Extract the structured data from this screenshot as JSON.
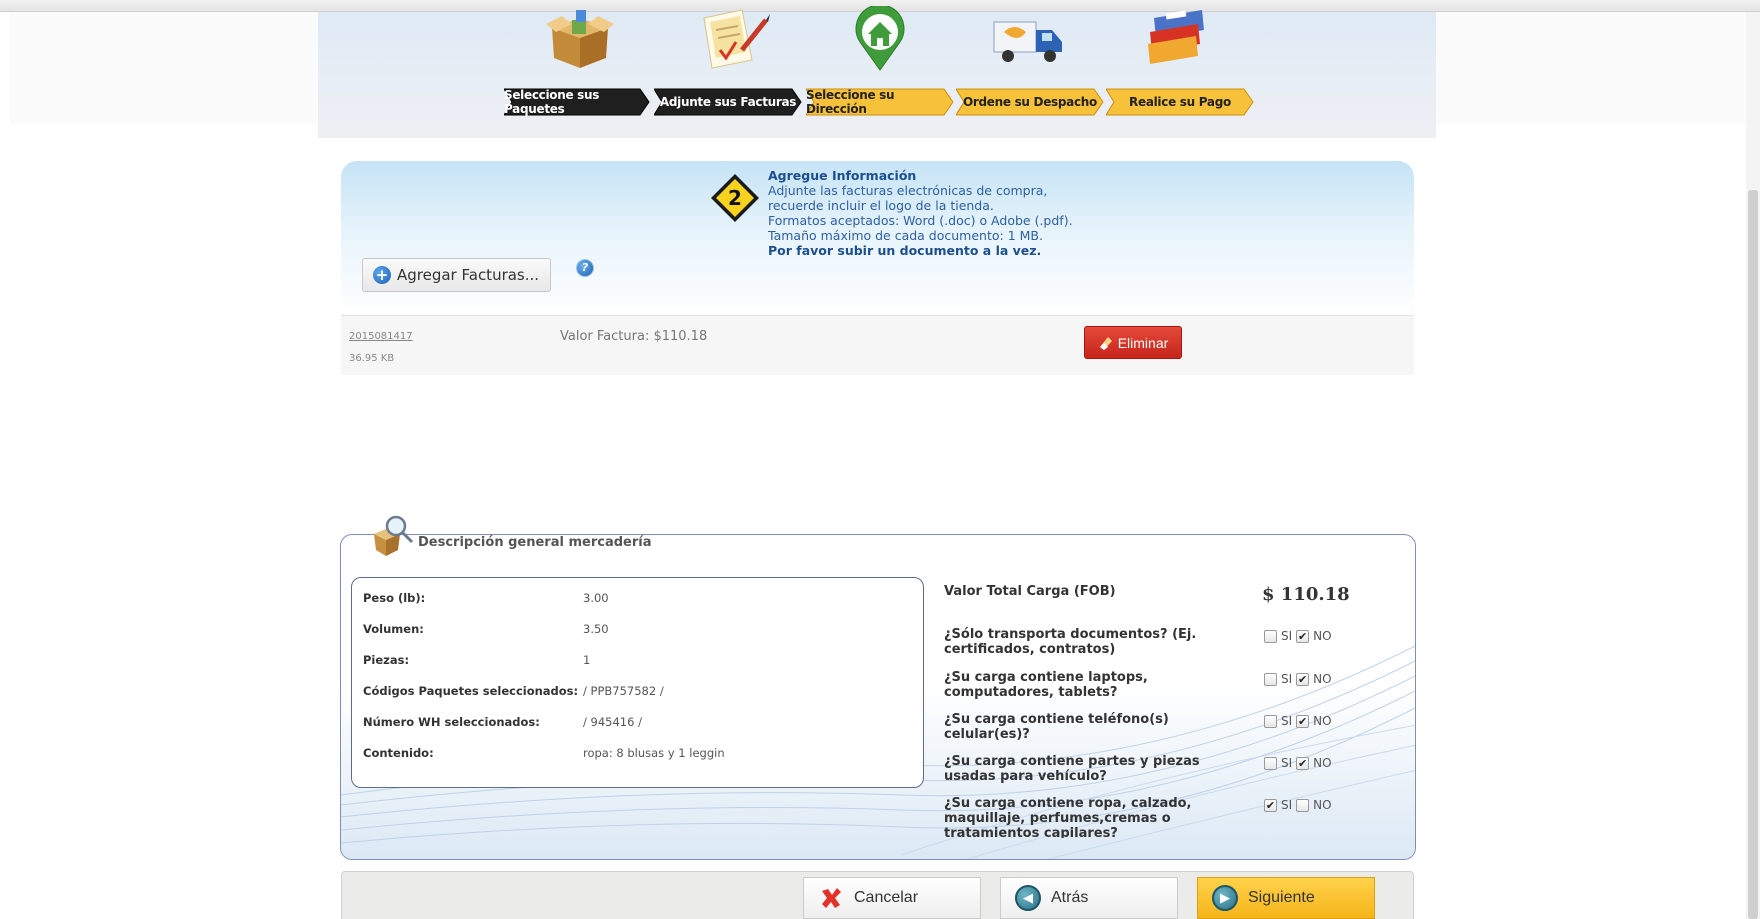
{
  "steps": [
    {
      "label": "Seleccione sus Paquetes",
      "icon": "package-box-icon"
    },
    {
      "label": "Adjunte sus Facturas",
      "icon": "invoice-pen-icon"
    },
    {
      "label": "Seleccione su Dirección",
      "icon": "home-pin-icon"
    },
    {
      "label": "Ordene su Despacho",
      "icon": "delivery-truck-icon"
    },
    {
      "label": "Realice su Pago",
      "icon": "credit-card-icon"
    }
  ],
  "info": {
    "step_number": "2",
    "title": "Agregue Información",
    "lines": [
      "Adjunte las facturas electrónicas de compra,",
      "recuerde incluir el logo de la tienda.",
      "Formatos aceptados: Word (.doc) o Adobe (.pdf).",
      "Tamaño máximo de cada documento: 1 MB."
    ],
    "bold_line": "Por favor subir un documento a la vez.",
    "add_button": "Agregar Facturas...",
    "help": "?"
  },
  "invoice": {
    "file_name": "2015081417",
    "file_size": "36.95 KB",
    "value": "Valor Factura: $110.18",
    "delete_button": "Eliminar"
  },
  "merch": {
    "title": "Descripción general mercadería",
    "details": [
      {
        "label": "Peso (lb):",
        "value": "3.00"
      },
      {
        "label": "Volumen:",
        "value": "3.50"
      },
      {
        "label": "Piezas:",
        "value": "1"
      },
      {
        "label": "Códigos Paquetes seleccionados:",
        "value": "/ PPB757582 /"
      },
      {
        "label": "Número WH seleccionados:",
        "value": "/ 945416 /"
      },
      {
        "label": "Contenido:",
        "value": "ropa: 8 blusas y 1 leggin"
      }
    ],
    "total_label": "Valor Total Carga (FOB)",
    "total_value": "$ 110.18",
    "yes_label": "SI",
    "no_label": "NO",
    "questions": [
      {
        "text": "¿Sólo transporta documentos? (Ej. certificados, contratos)",
        "yes": false,
        "no": true
      },
      {
        "text": "¿Su carga contiene laptops, computadores, tablets?",
        "yes": false,
        "no": true
      },
      {
        "text": "¿Su carga contiene teléfono(s) celular(es)?",
        "yes": false,
        "no": true
      },
      {
        "text": "¿Su carga contiene partes y piezas usadas para vehículo?",
        "yes": false,
        "no": true
      },
      {
        "text": "¿Su carga contiene ropa, calzado, maquillaje, perfumes,cremas o tratamientos capilares?",
        "yes": true,
        "no": false
      }
    ]
  },
  "footer": {
    "cancel": "Cancelar",
    "back": "Atrás",
    "next": "Siguiente"
  },
  "colors": {
    "step_dark": "#1f1f1f",
    "step_active": "#f7c23a",
    "link_blue": "#2d5fa3",
    "delete_red": "#d63324",
    "next_yellow": "#f5b51a"
  }
}
